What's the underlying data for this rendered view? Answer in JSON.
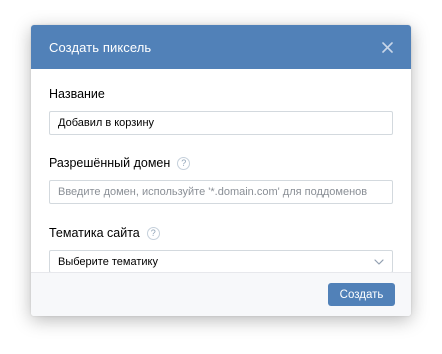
{
  "modal": {
    "title": "Создать пиксель",
    "close_icon": "close-icon"
  },
  "form": {
    "name": {
      "label": "Название",
      "value": "Добавил в корзину"
    },
    "domain": {
      "label": "Разрешённый домен",
      "help_icon": "question-icon",
      "placeholder": "Введите домен, используйте '*.domain.com' для поддоменов",
      "value": ""
    },
    "topic": {
      "label": "Тематика сайта",
      "help_icon": "question-icon",
      "selected": "Выберите тематику"
    }
  },
  "footer": {
    "create_label": "Создать"
  },
  "colors": {
    "accent": "#5181b8",
    "footer_bg": "#f7f8fa",
    "border": "#d3d9de"
  }
}
